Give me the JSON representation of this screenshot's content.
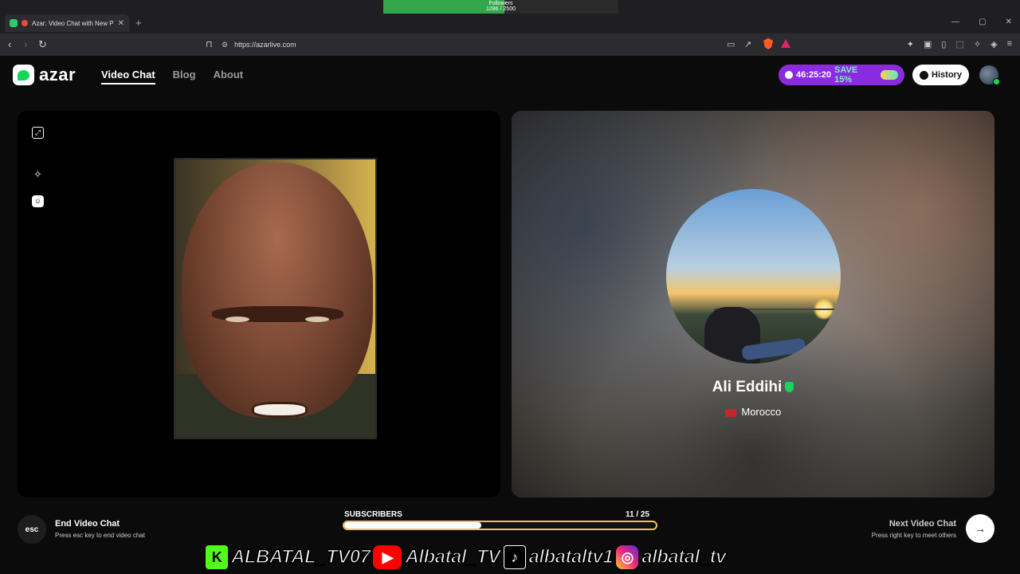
{
  "browser": {
    "tab_title": "Azar: Video Chat with New Pe",
    "url": "https://azarlive.com",
    "followers_widget": {
      "label": "Followers",
      "count_text": "1286 / 2500",
      "fraction": 0.5144
    }
  },
  "app": {
    "logo_text": "azar",
    "nav": [
      {
        "label": "Video Chat",
        "active": true
      },
      {
        "label": "Blog",
        "active": false
      },
      {
        "label": "About",
        "active": false
      }
    ],
    "promo": {
      "timer": "46:25:20",
      "save": "SAVE 15%",
      "accent": "#8a2be2"
    },
    "history_label": "History"
  },
  "partner": {
    "name": "Ali Eddihi",
    "country": "Morocco"
  },
  "controls": {
    "end_key": "esc",
    "end_title": "End Video Chat",
    "end_sub": "Press esc key to end video chat",
    "next_title": "Next Video Chat",
    "next_sub": "Press right key to meet others"
  },
  "overlay": {
    "subs_label": "SUBSCRIBERS",
    "subs_count": "11",
    "subs_goal": "/ 25",
    "subs_fraction": 0.44,
    "kick_handle": "ALBATAL_TV07",
    "youtube_handle": "Albatal_TV",
    "tiktok_handle": "albataltv1",
    "instagram_handle": "albatal_tv"
  },
  "colors": {
    "brand_green": "#17d45a",
    "progress_border": "#e8c45a"
  }
}
